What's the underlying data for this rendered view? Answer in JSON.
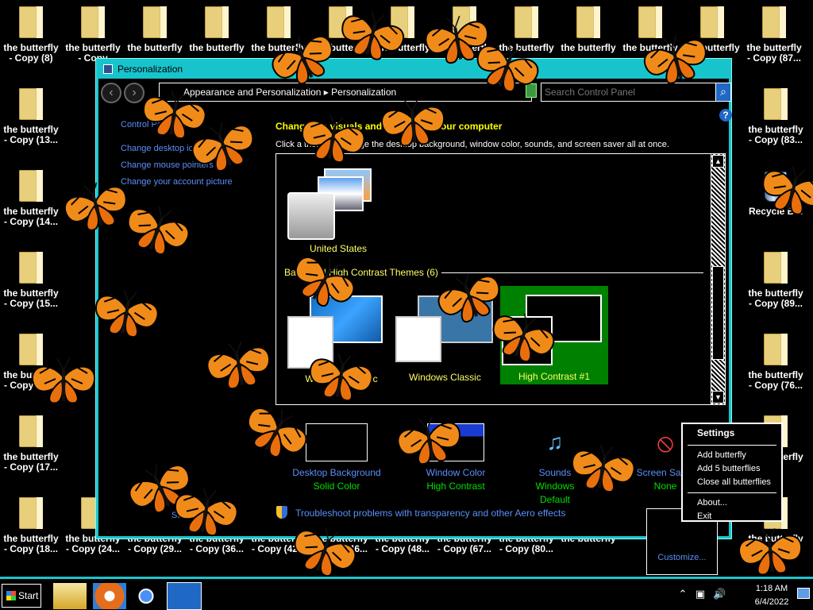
{
  "desktop": {
    "left_col": [
      [
        "the butterfly\n- Copy (8)"
      ],
      [
        "the butterfly\n- Copy (13..."
      ],
      [
        "the butterfly\n- Copy (14..."
      ],
      [
        "the butterfly\n- Copy (15..."
      ],
      [
        "the butterfly\n- Copy (16..."
      ],
      [
        "the butterfly\n- Copy (17..."
      ],
      [
        "the butterfly\n- Copy (18..."
      ]
    ],
    "top_row": [
      "the butterfly\n- Copy",
      "the butterfly",
      "the butterfly",
      "the butterfly",
      "the butterfly",
      "the butterfly",
      "the butterfly",
      "the butterfly",
      "the butterfly",
      "the butterfly",
      "the butterfly",
      "the butterfly\n- Copy (87..."
    ],
    "right_col": [
      "the butterfly\n- Copy (83...",
      "Recycle Bin",
      "the butterfly\n- Copy (89...",
      "the butterfly\n- Copy (76...",
      "the butterfly",
      "the butterfly\n- Copy (22)"
    ],
    "bottom_row": [
      "the butterfly\n- Copy (24...",
      "the butterfly\n- Copy (29...",
      "the butterfly\n- Copy (36...",
      "the butterfly\n- Copy (42...",
      "the butterfly\n- Copy (46...",
      "the butterfly\n- Copy (48...",
      "the butterfly\n- Copy (67...",
      "the butterfly\n- Copy (80...",
      "the butterfly"
    ]
  },
  "window": {
    "title": "Personalization",
    "breadcrumb": "Appearance and Personalization  ▸  Personalization",
    "search_placeholder": "Search Control Panel",
    "help": "?",
    "sidebar": [
      "Control Panel Home",
      "Change desktop icons",
      "Change mouse pointers",
      "Change your account picture"
    ],
    "sidebar_bottom": "Start Menu",
    "content_title": "Change the visuals and sounds on your computer",
    "content_sub": "Click a theme to change the desktop background, window color, sounds, and screen saver all at once.",
    "themes": [
      {
        "label": "United States"
      },
      {
        "label": "Windows 7 Basic"
      },
      {
        "label": "Windows Classic"
      },
      {
        "label": "High Contrast #1"
      }
    ],
    "group_title": "Basic and High Contrast Themes (6)",
    "bottom": [
      {
        "label": "Desktop Background",
        "value": "Solid Color"
      },
      {
        "label": "Window Color",
        "value": "High Contrast"
      },
      {
        "label": "Sounds",
        "value": "Windows Default"
      },
      {
        "label": "Screen Saver",
        "value": "None"
      }
    ],
    "troubleshoot": "Troubleshoot problems with transparency and other Aero effects"
  },
  "menu": {
    "header": "Settings",
    "items": [
      "Add butterfly",
      "Add 5 butterflies",
      "Close all butterflies",
      "About...",
      "Exit"
    ],
    "customize": "Customize..."
  },
  "taskbar": {
    "start": "Start",
    "time": "1:18 AM",
    "date": "6/4/2022"
  },
  "icons": {
    "close": "close-icon",
    "refresh": "refresh-icon",
    "search": "search-icon",
    "shield": "shield-icon",
    "speaker": "speaker-icon",
    "network": "network-icon",
    "chevron": "chevron-up-icon"
  },
  "colors": {
    "accent": "#19c6cf",
    "link": "#5b8ff8",
    "title_yellow": "#ffff00",
    "status_green": "#00e000",
    "butterfly_orange": "#f08b1a"
  }
}
